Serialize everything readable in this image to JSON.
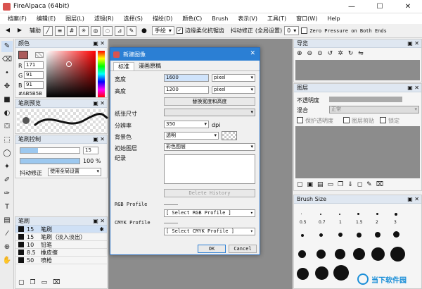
{
  "window": {
    "title": "FireAlpaca (64bit)",
    "controls": [
      "—",
      "☐",
      "✕"
    ]
  },
  "menu": [
    "档案(F)",
    "编辑(E)",
    "图层(L)",
    "滤镜(R)",
    "选择(S)",
    "描绘(D)",
    "颜色(C)",
    "Brush",
    "表示(V)",
    "工具(T)",
    "窗口(W)",
    "Help"
  ],
  "toolbar": {
    "assist_label": "辅助",
    "hand_select": "手绘",
    "antialias_label": "边缘柔化抗锯齿",
    "stabilizer_label": "抖动修正",
    "global_setting": "(全局设置)",
    "stabilizer_value": "0",
    "zero_pressure_label": "Zero Pressure on Both Ends"
  },
  "color_panel": {
    "title": "颜色",
    "r_label": "R",
    "r_value": "171",
    "g_label": "G",
    "g_value": "91",
    "b_label": "B",
    "b_value": "91",
    "hex": "#AB5B5B",
    "swatch_color": "#ab5b5b"
  },
  "brush_preview_panel": {
    "title": "笔刷预览"
  },
  "brush_control_panel": {
    "title": "笔刷控制",
    "size_value": "15",
    "opacity_value": "100 %",
    "stabilizer_label": "抖动修正",
    "stabilizer_select": "使用全局设置"
  },
  "brush_panel": {
    "title": "笔刷",
    "items": [
      {
        "size": "15",
        "name": "笔刷"
      },
      {
        "size": "15",
        "name": "笔刷（淡入淡出）"
      },
      {
        "size": "10",
        "name": "铅笔"
      },
      {
        "size": "8.5",
        "name": "橡皮擦"
      },
      {
        "size": "50",
        "name": "喷枪"
      }
    ]
  },
  "navigator_panel": {
    "title": "导览"
  },
  "layer_panel": {
    "title": "图层",
    "opacity_label": "不透明度",
    "blend_label": "混合",
    "blend_value": "正常",
    "protect_label": "保护透明度",
    "clip_label": "图层剪贴",
    "lock_label": "锁定"
  },
  "brush_size_panel": {
    "title": "Brush Size",
    "sizes": [
      "0.5",
      "0.7",
      "1",
      "1.5",
      "2",
      "3",
      "",
      "",
      "",
      "",
      "",
      ""
    ]
  },
  "dialog": {
    "title": "新建图像",
    "tabs": [
      "标准",
      "漫画原稿"
    ],
    "width_label": "宽度",
    "width_value": "1600",
    "width_unit": "pixel",
    "height_label": "高度",
    "height_value": "1200",
    "height_unit": "pixel",
    "swap_button": "替换宽度和高度",
    "paper_label": "纸张尺寸",
    "resolution_label": "分辨率",
    "resolution_value": "350",
    "resolution_unit": "dpi",
    "background_label": "背景色",
    "background_value": "透明",
    "init_layer_label": "初始图层",
    "init_layer_value": "彩色图层",
    "notes_label": "纪录",
    "delete_history_button": "Delete History",
    "rgb_label": "RGB Profile",
    "rgb_select": "[ Select RGB Profile ]",
    "cmyk_label": "CMYK Profile",
    "cmyk_select": "[ Select CMYK Profile ]",
    "ok_button": "OK",
    "cancel_button": "Cancel"
  },
  "watermark": "当下软件园"
}
